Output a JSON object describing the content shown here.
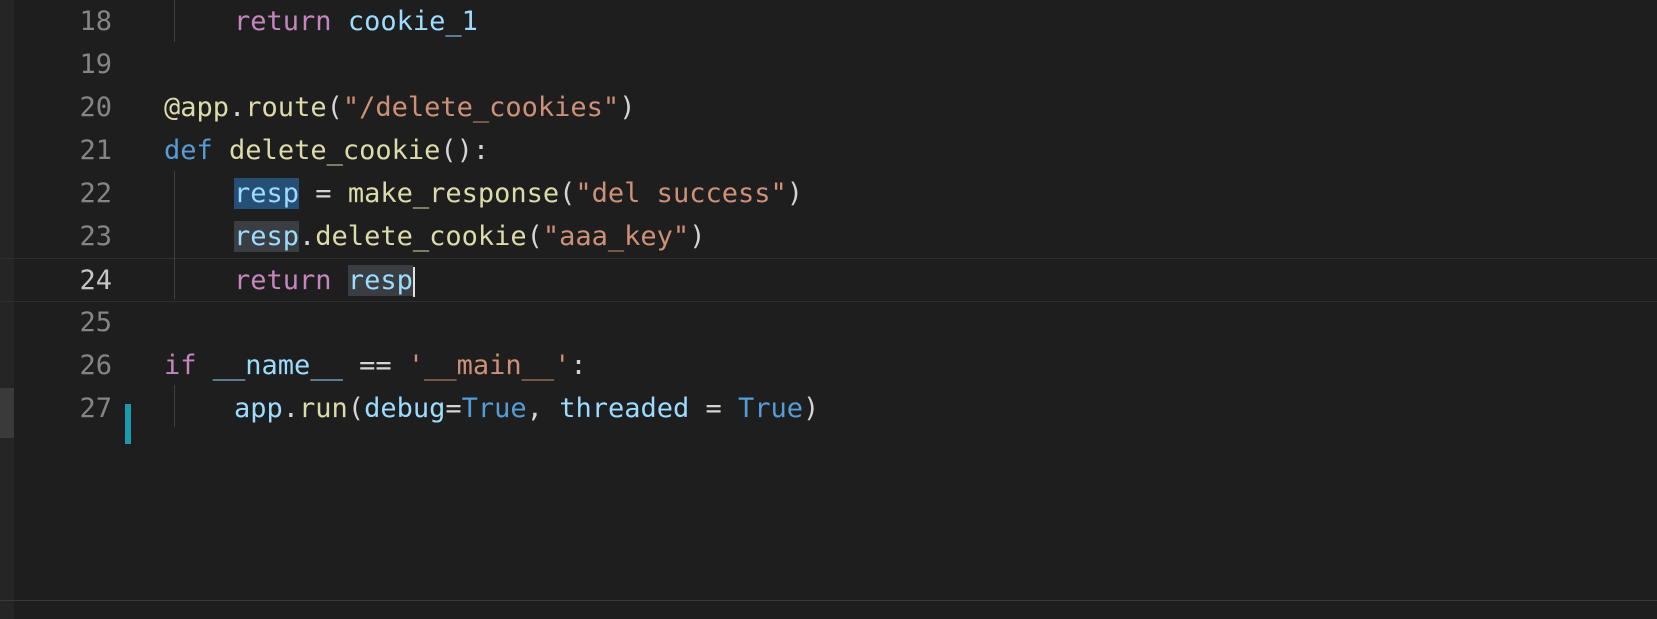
{
  "lines": [
    {
      "num": "18",
      "indent": "    ",
      "tokens": [
        [
          "kw2",
          "return"
        ],
        [
          "plain",
          " "
        ],
        [
          "var",
          "cookie_1"
        ]
      ]
    },
    {
      "num": "19",
      "indent": "",
      "tokens": []
    },
    {
      "num": "20",
      "indent": "",
      "tokens": [
        [
          "fn",
          "@app"
        ],
        [
          "plain",
          "."
        ],
        [
          "fn",
          "route"
        ],
        [
          "plain",
          "("
        ],
        [
          "str",
          "\"/delete_cookies\""
        ],
        [
          "plain",
          ")"
        ]
      ]
    },
    {
      "num": "21",
      "indent": "",
      "tokens": [
        [
          "kw",
          "def"
        ],
        [
          "plain",
          " "
        ],
        [
          "fn",
          "delete_cookie"
        ],
        [
          "plain",
          "():"
        ]
      ]
    },
    {
      "num": "22",
      "indent": "    ",
      "tokens": [
        [
          "var hl-read",
          "resp"
        ],
        [
          "plain",
          " = "
        ],
        [
          "fn",
          "make_response"
        ],
        [
          "plain",
          "("
        ],
        [
          "str",
          "\"del success\""
        ],
        [
          "plain",
          ")"
        ]
      ]
    },
    {
      "num": "23",
      "indent": "    ",
      "tokens": [
        [
          "var hl-word",
          "resp"
        ],
        [
          "plain",
          "."
        ],
        [
          "fn",
          "delete_cookie"
        ],
        [
          "plain",
          "("
        ],
        [
          "str",
          "\"aaa_key\""
        ],
        [
          "plain",
          ")"
        ]
      ]
    },
    {
      "num": "24",
      "indent": "    ",
      "tokens": [
        [
          "kw2",
          "return"
        ],
        [
          "plain",
          " "
        ],
        [
          "var hl-word",
          "resp"
        ],
        [
          "cursor",
          ""
        ]
      ]
    },
    {
      "num": "25",
      "indent": "",
      "tokens": []
    },
    {
      "num": "26",
      "indent": "",
      "tokens": [
        [
          "kw2",
          "if"
        ],
        [
          "plain",
          " "
        ],
        [
          "var",
          "__name__"
        ],
        [
          "plain",
          " == "
        ],
        [
          "str",
          "'__main__'"
        ],
        [
          "plain",
          ":"
        ]
      ]
    },
    {
      "num": "27",
      "indent": "    ",
      "tokens": [
        [
          "var",
          "app"
        ],
        [
          "plain",
          "."
        ],
        [
          "fn",
          "run"
        ],
        [
          "plain",
          "("
        ],
        [
          "var",
          "debug"
        ],
        [
          "plain",
          "="
        ],
        [
          "const",
          "True"
        ],
        [
          "plain",
          ", "
        ],
        [
          "var",
          "threaded"
        ],
        [
          "plain",
          " = "
        ],
        [
          "const",
          "True"
        ],
        [
          "plain",
          ")"
        ]
      ]
    }
  ],
  "current_line": "24",
  "modified_line": "27",
  "colors": {
    "background": "#1e1e1e",
    "keyword": "#569cd6",
    "control": "#c586c0",
    "function": "#dcdcaa",
    "string": "#ce9178",
    "variable": "#9cdcfe",
    "gutter_modified": "#1b9aac"
  }
}
